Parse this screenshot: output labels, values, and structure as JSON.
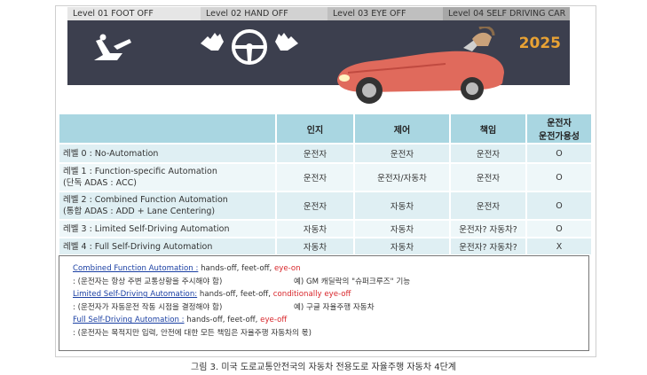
{
  "banner": {
    "levels": [
      "Level 01 FOOT OFF",
      "Level 02 HAND OFF",
      "Level 03 EYE OFF",
      "Level 04 SELF DRIVING CAR"
    ],
    "year": "2025"
  },
  "table": {
    "headers": [
      "",
      "인지",
      "제어",
      "책임",
      "운전자\n운전가용성"
    ],
    "header_last_line1": "운전자",
    "header_last_line2": "운전가용성",
    "rows": [
      {
        "label1": "레벨 0 : No-Automation",
        "label2": "",
        "c1": "운전자",
        "c2": "운전자",
        "c3": "운전자",
        "c4": "O"
      },
      {
        "label1": "레벨 1 : Function-specific Automation",
        "label2": "(단독 ADAS : ACC)",
        "c1": "운전자",
        "c2": "운전자/자동차",
        "c3": "운전자",
        "c4": "O"
      },
      {
        "label1": "레벨 2 : Combined Function Automation",
        "label2": "(통합 ADAS : ADD + Lane Centering)",
        "c1": "운전자",
        "c2": "자동차",
        "c3": "운전자",
        "c4": "O"
      },
      {
        "label1": "레벨 3 : Limited Self-Driving Automation",
        "label2": "",
        "c1": "자동차",
        "c2": "자동차",
        "c3": "운전자? 자동차?",
        "c4": "O"
      },
      {
        "label1": "레벨 4 : Full Self-Driving Automation",
        "label2": "",
        "c1": "자동차",
        "c2": "자동차",
        "c3": "운전자? 자동차?",
        "c4": "X"
      }
    ]
  },
  "notes": {
    "n1_head": "Combined Function Automation :",
    "n1_mid": " hands-off, feet-off, ",
    "n1_red": "eye-on",
    "n1_sub": ": (운전자는 항상 주변 교통상황을 주시해야 함)",
    "n1_ex": "예) GM 캐딜락의 \"슈퍼크루즈\" 기능",
    "n2_head": "Limited Self-Driving Automation:",
    "n2_mid": " hands-off, feet-off, ",
    "n2_red": "conditionally eye-off",
    "n2_sub": ": (운전자가 자동운전 작동 시점을 결정해야 함)",
    "n2_ex": "예) 구글 자율주행 자동차",
    "n3_head": "Full Self-Driving Automation :",
    "n3_mid": " hands-off, feet-off, ",
    "n3_red": "eye-off",
    "n3_sub": ": (운전자는 목적지만 입력, 안전에 대한 모든 책임은 자율주행 자동차의 몫)"
  },
  "caption": "그림 3. 미국 도로교통안전국의 자동차 전용도로 자율주행 자동차 4단계",
  "colors": {
    "header_bg": "#a9d6e1",
    "row_odd": "#dfeff3",
    "row_even": "#eef7f9",
    "banner_dark": "#3c3f4e",
    "year": "#e8a234",
    "note_link": "#1a3fa3",
    "note_red": "#d8262b",
    "car": "#e06a5c"
  }
}
